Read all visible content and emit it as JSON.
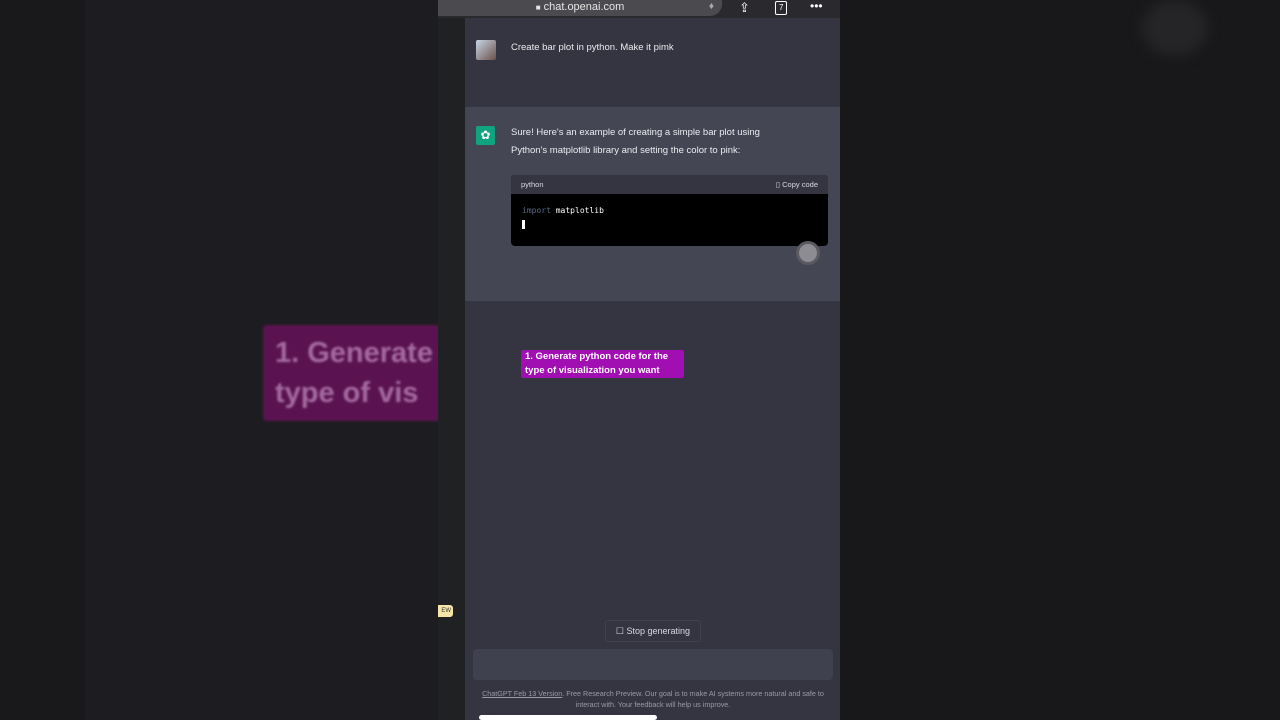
{
  "browser": {
    "url": "chat.openai.com",
    "tab_count": "7"
  },
  "background_caption": "1. Generate type of vis",
  "chat": {
    "user_message": "Create bar plot in python. Make it pimk",
    "assistant_message_line1": "Sure! Here's an example of creating a simple bar plot using",
    "assistant_message_line2": "Python's matplotlib library and setting the color to pink:",
    "code_block": {
      "language": "python",
      "copy_label": "Copy code",
      "keyword": "import",
      "module": "matplotlib"
    }
  },
  "overlay_caption": "1. Generate python code for the type of visualization you want",
  "sidebar": {
    "badge": "EW"
  },
  "stop_label": "Stop generating",
  "footer": {
    "link": "ChatGPT Feb 13 Version",
    "text": ". Free Research Preview. Our goal is to make AI systems more natural and safe to interact with. Your feedback will help us improve."
  }
}
